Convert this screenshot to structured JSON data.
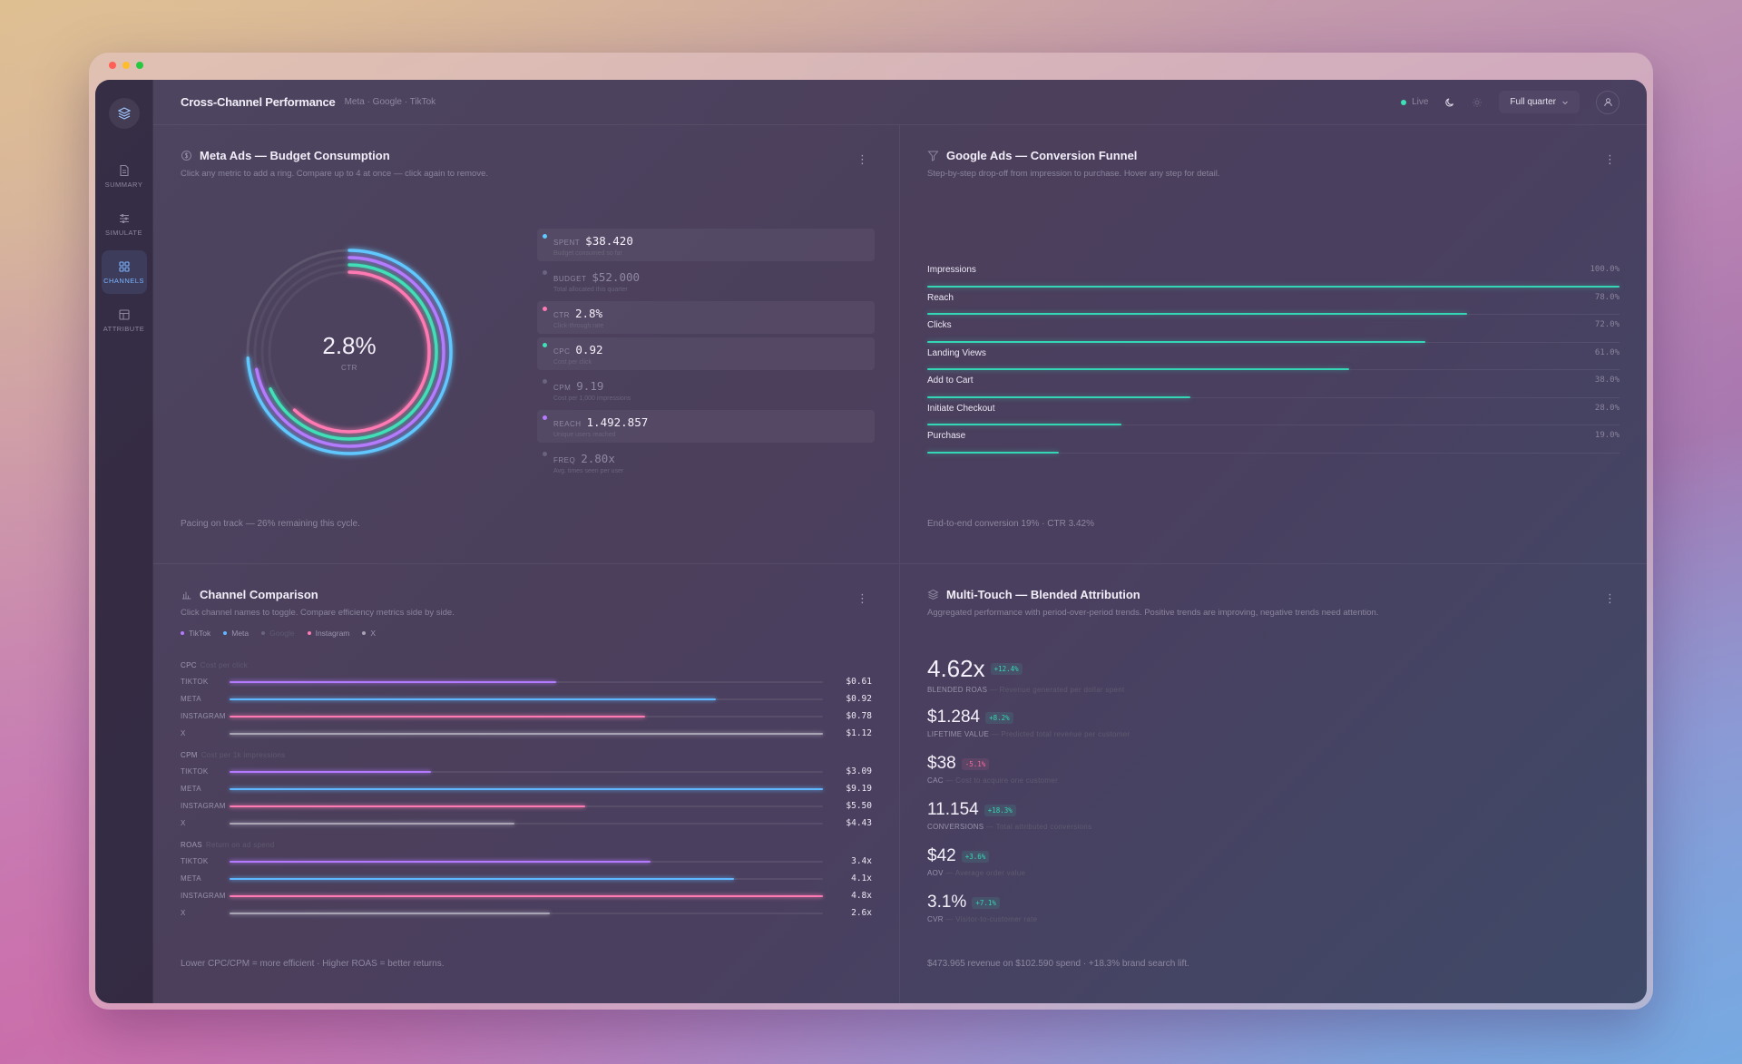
{
  "app": {
    "title": "Cross-Channel Performance",
    "subtitle": "Meta · Google · TikTok",
    "live_label": "Live",
    "range_label": "Full quarter"
  },
  "sidebar": {
    "items": [
      {
        "label": "SUMMARY",
        "icon": "document-icon"
      },
      {
        "label": "SIMULATE",
        "icon": "sliders-icon"
      },
      {
        "label": "CHANNELS",
        "icon": "grid-icon",
        "active": true
      },
      {
        "label": "ATTRIBUTE",
        "icon": "table-icon"
      }
    ]
  },
  "meta_card": {
    "title": "Meta Ads — Budget Consumption",
    "desc": "Click any metric to add a ring. Compare up to 4 at once — click again to remove.",
    "center_value": "2.8%",
    "center_label": "CTR",
    "footer": "Pacing on track — 26% remaining this cycle.",
    "metrics": [
      {
        "key": "SPENT",
        "value": "$38.420",
        "sub": "Budget consumed so far",
        "on": true,
        "color": "#5fc8ff",
        "ring": 0.74
      },
      {
        "key": "BUDGET",
        "value": "$52.000",
        "sub": "Total allocated this quarter",
        "on": false,
        "color": "#6a6480"
      },
      {
        "key": "CTR",
        "value": "2.8%",
        "sub": "Click-through rate",
        "on": true,
        "color": "#ff7ab2",
        "ring": 0.62
      },
      {
        "key": "CPC",
        "value": "0.92",
        "sub": "Cost per click",
        "on": true,
        "color": "#40e0b8",
        "ring": 0.68
      },
      {
        "key": "CPM",
        "value": "9.19",
        "sub": "Cost per 1,000 impressions",
        "on": false,
        "color": "#6a6480"
      },
      {
        "key": "REACH",
        "value": "1.492.857",
        "sub": "Unique users reached",
        "on": true,
        "color": "#b47aff",
        "ring": 0.72
      },
      {
        "key": "FREQ",
        "value": "2.80x",
        "sub": "Avg. times seen per user",
        "on": false,
        "color": "#6a6480"
      }
    ]
  },
  "funnel_card": {
    "title": "Google Ads — Conversion Funnel",
    "desc": "Step-by-step drop-off from impression to purchase. Hover any step for detail.",
    "footer": "End-to-end conversion 19% · CTR 3.42%",
    "steps": [
      {
        "name": "Impressions",
        "pct": "100.0%",
        "value": 100
      },
      {
        "name": "Reach",
        "pct": "78.0%",
        "value": 78
      },
      {
        "name": "Clicks",
        "pct": "72.0%",
        "value": 72
      },
      {
        "name": "Landing Views",
        "pct": "61.0%",
        "value": 61
      },
      {
        "name": "Add to Cart",
        "pct": "38.0%",
        "value": 38
      },
      {
        "name": "Initiate Checkout",
        "pct": "28.0%",
        "value": 28
      },
      {
        "name": "Purchase",
        "pct": "19.0%",
        "value": 19
      }
    ]
  },
  "compare_card": {
    "title": "Channel Comparison",
    "desc": "Click channel names to toggle. Compare efficiency metrics side by side.",
    "footer": "Lower CPC/CPM = more efficient · Higher ROAS = better returns.",
    "legend": [
      {
        "name": "TikTok",
        "color": "#b47aff",
        "on": true
      },
      {
        "name": "Meta",
        "color": "#5fb8ff",
        "on": true
      },
      {
        "name": "Google",
        "color": "#6a6480",
        "on": false
      },
      {
        "name": "Instagram",
        "color": "#ff7ab2",
        "on": true
      },
      {
        "name": "X",
        "color": "#a8a4b4",
        "on": true
      }
    ],
    "groups": [
      {
        "name": "CPC",
        "note": "Cost per click",
        "rows": [
          {
            "channel": "TIKTOK",
            "value": "$0.61",
            "fill": 0.55,
            "color": "#b47aff"
          },
          {
            "channel": "META",
            "value": "$0.92",
            "fill": 0.82,
            "color": "#5fb8ff"
          },
          {
            "channel": "INSTAGRAM",
            "value": "$0.78",
            "fill": 0.7,
            "color": "#ff7ab2"
          },
          {
            "channel": "X",
            "value": "$1.12",
            "fill": 1.0,
            "color": "#a8a4b4"
          }
        ]
      },
      {
        "name": "CPM",
        "note": "Cost per 1k impressions",
        "rows": [
          {
            "channel": "TIKTOK",
            "value": "$3.09",
            "fill": 0.34,
            "color": "#b47aff"
          },
          {
            "channel": "META",
            "value": "$9.19",
            "fill": 1.0,
            "color": "#5fb8ff"
          },
          {
            "channel": "INSTAGRAM",
            "value": "$5.50",
            "fill": 0.6,
            "color": "#ff7ab2"
          },
          {
            "channel": "X",
            "value": "$4.43",
            "fill": 0.48,
            "color": "#a8a4b4"
          }
        ]
      },
      {
        "name": "ROAS",
        "note": "Return on ad spend",
        "rows": [
          {
            "channel": "TIKTOK",
            "value": "3.4x",
            "fill": 0.71,
            "color": "#b47aff"
          },
          {
            "channel": "META",
            "value": "4.1x",
            "fill": 0.85,
            "color": "#5fb8ff"
          },
          {
            "channel": "INSTAGRAM",
            "value": "4.8x",
            "fill": 1.0,
            "color": "#ff7ab2"
          },
          {
            "channel": "X",
            "value": "2.6x",
            "fill": 0.54,
            "color": "#a8a4b4"
          }
        ]
      }
    ]
  },
  "attribution_card": {
    "title": "Multi-Touch — Blended Attribution",
    "desc": "Aggregated performance with period-over-period trends. Positive trends are improving, negative trends need attention.",
    "footer": "$473.965 revenue on $102.590 spend · +18.3% brand search lift.",
    "kpis": [
      {
        "value": "4.62x",
        "badge": "+12.4%",
        "trend": "up",
        "label": "BLENDED ROAS",
        "note": "— Revenue generated per dollar spent"
      },
      {
        "value": "$1.284",
        "badge": "+8.2%",
        "trend": "up",
        "label": "LIFETIME VALUE",
        "note": "— Predicted total revenue per customer"
      },
      {
        "value": "$38",
        "badge": "-5.1%",
        "trend": "down",
        "label": "CAC",
        "note": "— Cost to acquire one customer"
      },
      {
        "value": "11.154",
        "badge": "+18.3%",
        "trend": "up",
        "label": "CONVERSIONS",
        "note": "— Total attributed conversions"
      },
      {
        "value": "$42",
        "badge": "+3.6%",
        "trend": "up",
        "label": "AOV",
        "note": "— Average order value"
      },
      {
        "value": "3.1%",
        "badge": "+7.1%",
        "trend": "up",
        "label": "CVR",
        "note": "— Visitor-to-customer rate"
      }
    ]
  }
}
